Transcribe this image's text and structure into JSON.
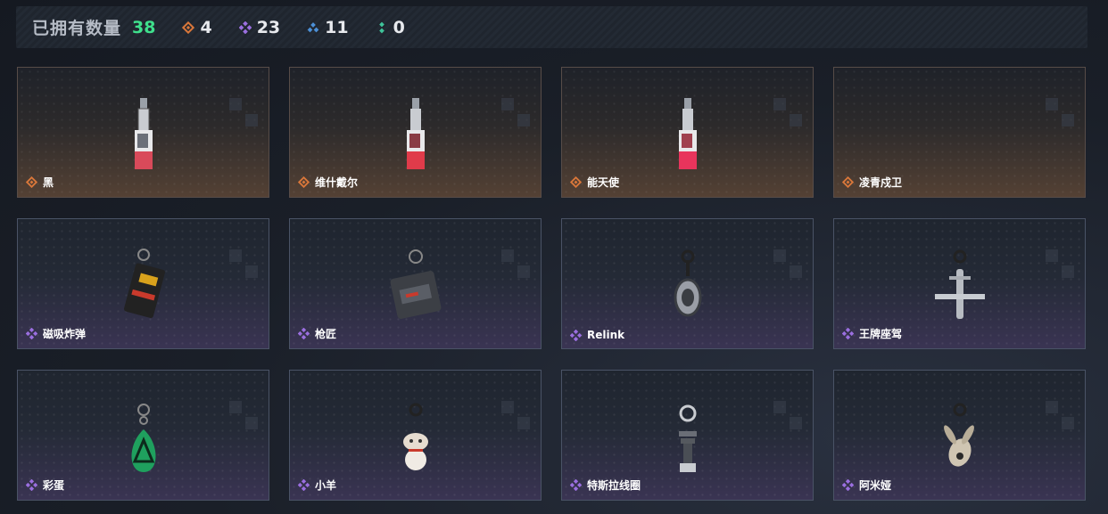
{
  "header": {
    "title": "已拥有数量",
    "total": "38",
    "stats": [
      {
        "icon": "orange-diamond-icon",
        "value": "4",
        "color": "#d9773a"
      },
      {
        "icon": "purple-diamond-icon",
        "value": "23",
        "color": "#9b6fe0"
      },
      {
        "icon": "blue-triangle-icon",
        "value": "11",
        "color": "#4c8fd6"
      },
      {
        "icon": "green-dots-icon",
        "value": "0",
        "color": "#3fc49a"
      }
    ]
  },
  "colors": {
    "orange": "#d9773a",
    "purple": "#9b6fe0",
    "total": "#3fe08c"
  },
  "cards": [
    {
      "name": "黑",
      "rarity": "orange",
      "item": "tag"
    },
    {
      "name": "维什戴尔",
      "rarity": "orange",
      "item": "tag"
    },
    {
      "name": "能天使",
      "rarity": "orange",
      "item": "tag"
    },
    {
      "name": "凌青戍卫",
      "rarity": "orange",
      "item": "none"
    },
    {
      "name": "磁吸炸弹",
      "rarity": "purple",
      "item": "bomb"
    },
    {
      "name": "枪匠",
      "rarity": "purple",
      "item": "crate"
    },
    {
      "name": "Relink",
      "rarity": "purple",
      "item": "turtle"
    },
    {
      "name": "王牌座驾",
      "rarity": "purple",
      "item": "plane"
    },
    {
      "name": "彩蛋",
      "rarity": "purple",
      "item": "egg"
    },
    {
      "name": "小羊",
      "rarity": "purple",
      "item": "sheep"
    },
    {
      "name": "特斯拉线圈",
      "rarity": "purple",
      "item": "coil"
    },
    {
      "name": "阿米娅",
      "rarity": "purple",
      "item": "bunny"
    }
  ]
}
